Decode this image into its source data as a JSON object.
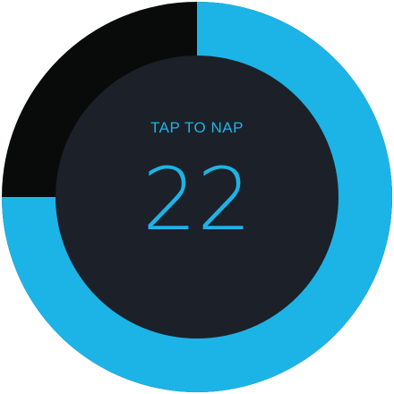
{
  "nap_dial": {
    "prompt": "TAP TO NAP",
    "minutes": "22",
    "progress_fraction": 0.75,
    "colors": {
      "ring_fill": "#1cb4e6",
      "ring_empty": "#080b0a",
      "face": "#1c2029",
      "text": "#1cb4e6",
      "background": "#ffffff"
    }
  }
}
